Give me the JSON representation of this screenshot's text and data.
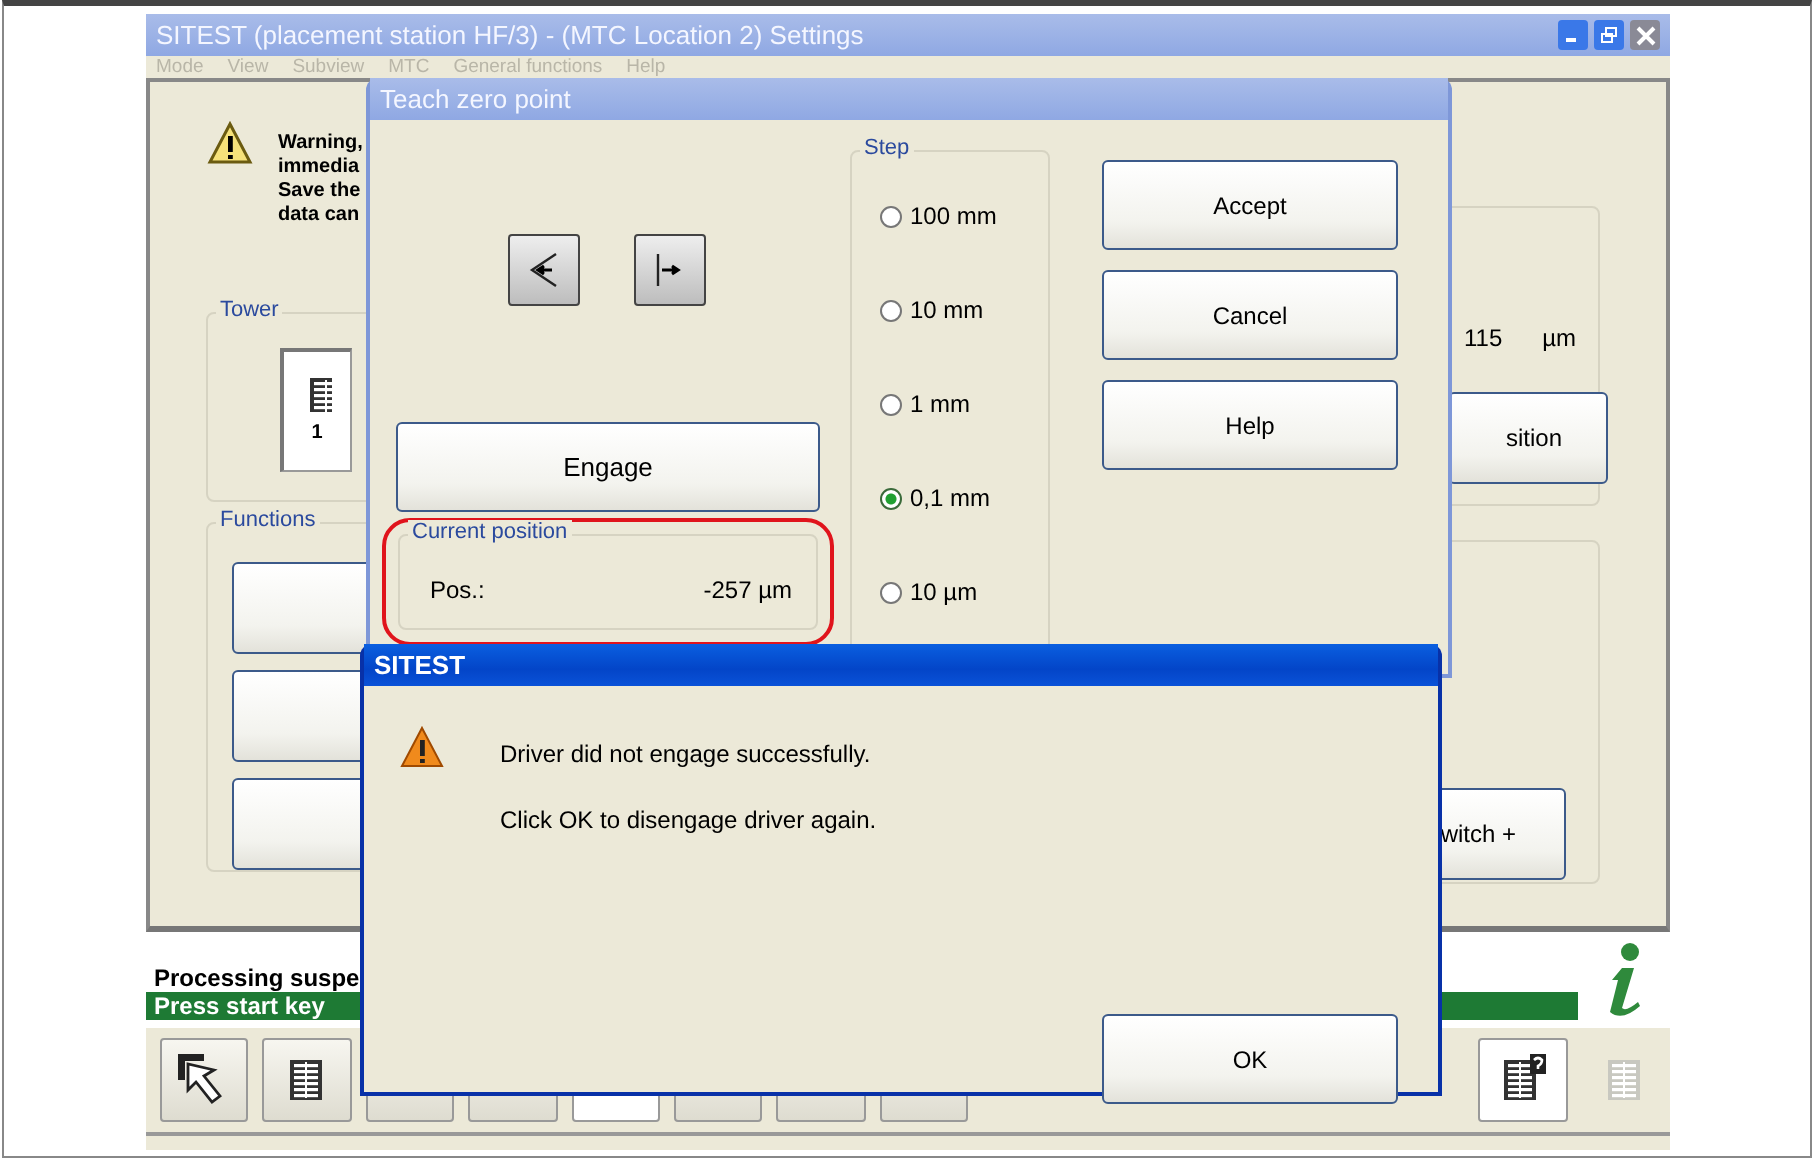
{
  "main_window": {
    "title": "SITEST (placement station HF/3) - (MTC Location 2) Settings",
    "active": false,
    "menu": [
      {
        "label": "Mode",
        "disabled": true
      },
      {
        "label": "View",
        "disabled": true
      },
      {
        "label": "Subview",
        "disabled": true
      },
      {
        "label": "MTC",
        "disabled": true
      },
      {
        "label": "General functions",
        "disabled": true
      },
      {
        "label": "Help",
        "disabled": true
      }
    ],
    "warning_lines": [
      "Warning,",
      "immedia",
      "Save the",
      "data can"
    ],
    "tower": {
      "label": "Tower",
      "number": "1"
    },
    "functions": {
      "label": "Functions"
    },
    "offset": {
      "value": "115",
      "unit": "µm",
      "button": "sition"
    },
    "switch_button": "witch +",
    "status": {
      "message": "Processing suspe",
      "prompt": "Press start key"
    },
    "toolbar": [
      {
        "kind": "pointer",
        "selected": false,
        "disabled": false
      },
      {
        "kind": "list",
        "selected": false,
        "disabled": false
      },
      {
        "kind": "blank",
        "selected": false,
        "disabled": false
      },
      {
        "kind": "blank",
        "selected": false,
        "disabled": false
      },
      {
        "kind": "blank",
        "selected": true,
        "disabled": false
      },
      {
        "kind": "blank",
        "selected": false,
        "disabled": false
      },
      {
        "kind": "blank",
        "selected": false,
        "disabled": false
      },
      {
        "kind": "blank",
        "selected": false,
        "disabled": false
      },
      {
        "kind": "list-help",
        "selected": true,
        "disabled": false
      },
      {
        "kind": "list",
        "selected": false,
        "disabled": true
      }
    ]
  },
  "teach_dialog": {
    "title": "Teach zero point",
    "active": false,
    "engage": "Engage",
    "current_position": {
      "label": "Current position",
      "pos_label": "Pos.:",
      "value": "-257 µm",
      "highlighted": true
    },
    "step": {
      "label": "Step",
      "options": [
        {
          "label": "100 mm",
          "selected": false
        },
        {
          "label": "10 mm",
          "selected": false
        },
        {
          "label": "1 mm",
          "selected": false
        },
        {
          "label": "0,1 mm",
          "selected": true
        },
        {
          "label": "10 µm",
          "selected": false
        }
      ]
    },
    "buttons": [
      "Accept",
      "Cancel",
      "Help"
    ]
  },
  "message_dialog": {
    "title": "SITEST",
    "active": true,
    "lines": [
      "Driver did not engage successfully.",
      "Click OK to disengage driver again."
    ],
    "button": "OK"
  }
}
